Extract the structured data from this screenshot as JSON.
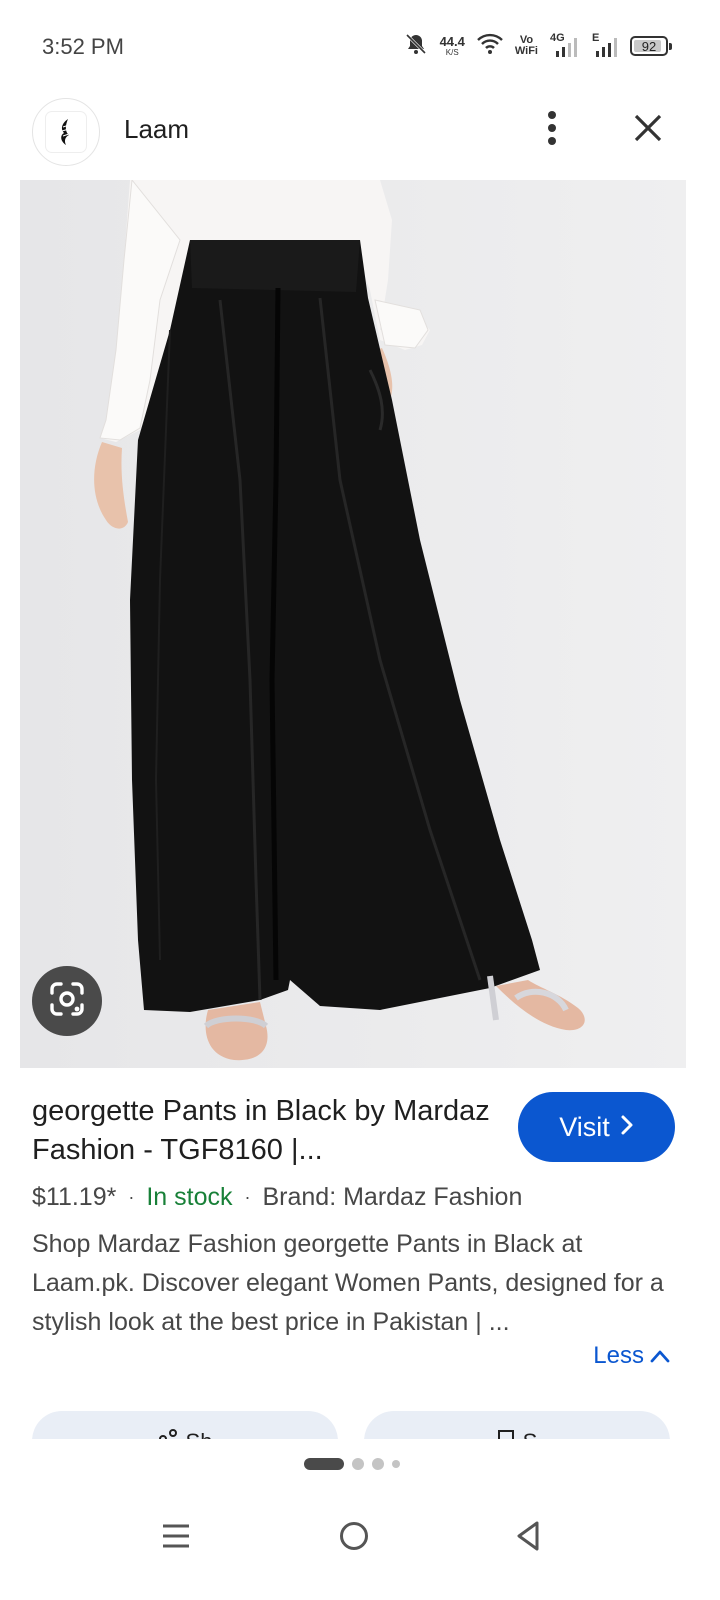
{
  "status_bar": {
    "time": "3:52 PM",
    "net_speed": "44.4",
    "net_speed_unit": "K/S",
    "vowifi_top": "Vo",
    "vowifi_bottom": "WiFi",
    "network_4g": "4G",
    "network_e": "E",
    "battery": "92",
    "battery_level": 0.92
  },
  "header": {
    "site_name": "Laam",
    "logo_icon": "laam-logo-icon",
    "more_icon": "more-vert-icon",
    "close_icon": "close-icon"
  },
  "product": {
    "image_icon": "product-photo",
    "lens_icon": "google-lens-icon"
  },
  "result": {
    "title": "georgette Pants in Black by Mardaz Fashion - TGF8160 |...",
    "visit_label": "Visit",
    "price": "$11.19*",
    "stock": "In stock",
    "brand": "Brand: Mardaz Fashion",
    "description": "Shop Mardaz Fashion georgette Pants in Black at Laam.pk. Discover elegant Women Pants, designed for a stylish look at the best price in Pakistan | ...",
    "less_label": "Less"
  },
  "chips": [
    {
      "label": "Sh",
      "icon": "share-icon"
    },
    {
      "label": "S",
      "icon": "save-icon"
    }
  ],
  "pager": {
    "pages": 4,
    "active_index": 0
  },
  "colors": {
    "accent": "#0b57d0",
    "stock_green": "#188038",
    "chip_bg": "#e9eef6"
  },
  "nav": {
    "menu_icon": "menu-icon",
    "home_icon": "home-circle-icon",
    "back_icon": "back-triangle-icon"
  }
}
